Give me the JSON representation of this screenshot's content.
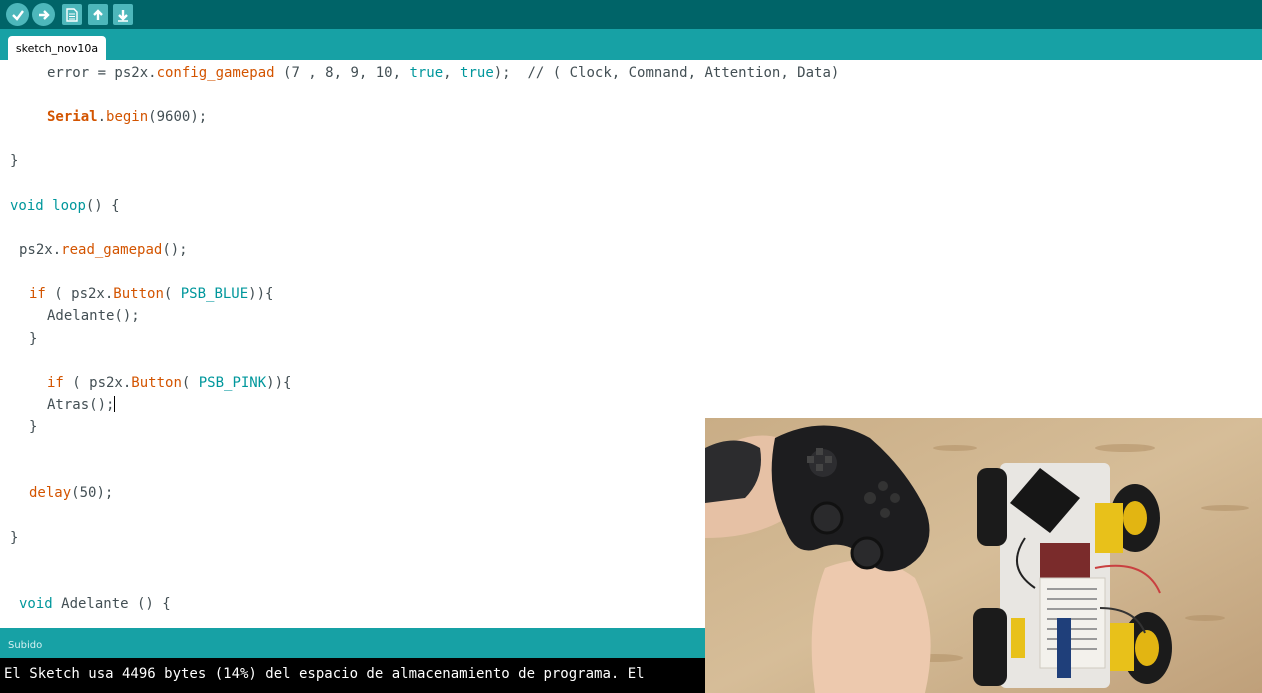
{
  "toolbar": {
    "buttons": [
      {
        "name": "verify-button",
        "icon": "check-icon"
      },
      {
        "name": "upload-button",
        "icon": "arrow-right-icon"
      },
      {
        "name": "new-button",
        "icon": "new-file-icon"
      },
      {
        "name": "open-button",
        "icon": "arrow-up-icon"
      },
      {
        "name": "save-button",
        "icon": "arrow-down-icon"
      }
    ]
  },
  "tabs": [
    {
      "label": "sketch_nov10a"
    }
  ],
  "code": {
    "l1": {
      "a": "error = ps2x.",
      "b": "config_gamepad",
      "c": " (7 , 8, 9, 10, ",
      "d": "true",
      "e": ", ",
      "f": "true",
      "g": ");  // ( Clock, Comnand, Attention, Data)"
    },
    "l2": {
      "a": "Serial",
      "b": ".",
      "c": "begin",
      "d": "(9600);"
    },
    "l3": "}",
    "l4": {
      "a": "void",
      "b": " ",
      "c": "loop",
      "d": "() {"
    },
    "l5": {
      "a": "ps2x.",
      "b": "read_gamepad",
      "c": "();"
    },
    "l6": {
      "a": "if",
      "b": " ( ps2x.",
      "c": "Button",
      "d": "( ",
      "e": "PSB_BLUE",
      "f": ")){"
    },
    "l7": "Adelante();",
    "l8": "}",
    "l9": {
      "a": "if",
      "b": " ( ps2x.",
      "c": "Button",
      "d": "( ",
      "e": "PSB_PINK",
      "f": ")){"
    },
    "l10": "Atras();",
    "l11": "}",
    "l12": {
      "a": "delay",
      "b": "(50);"
    },
    "l13": "}",
    "l14": {
      "a": "void",
      "b": " Adelante () {"
    }
  },
  "status": {
    "text": "Subido"
  },
  "console": {
    "line1": "El Sketch usa 4496 bytes (14%) del espacio de almacenamiento de programa. El"
  },
  "colors": {
    "toolbar": "#006468",
    "tabbar": "#17a1a5",
    "function": "#d35400",
    "keyword": "#00979c",
    "text": "#434f54"
  }
}
